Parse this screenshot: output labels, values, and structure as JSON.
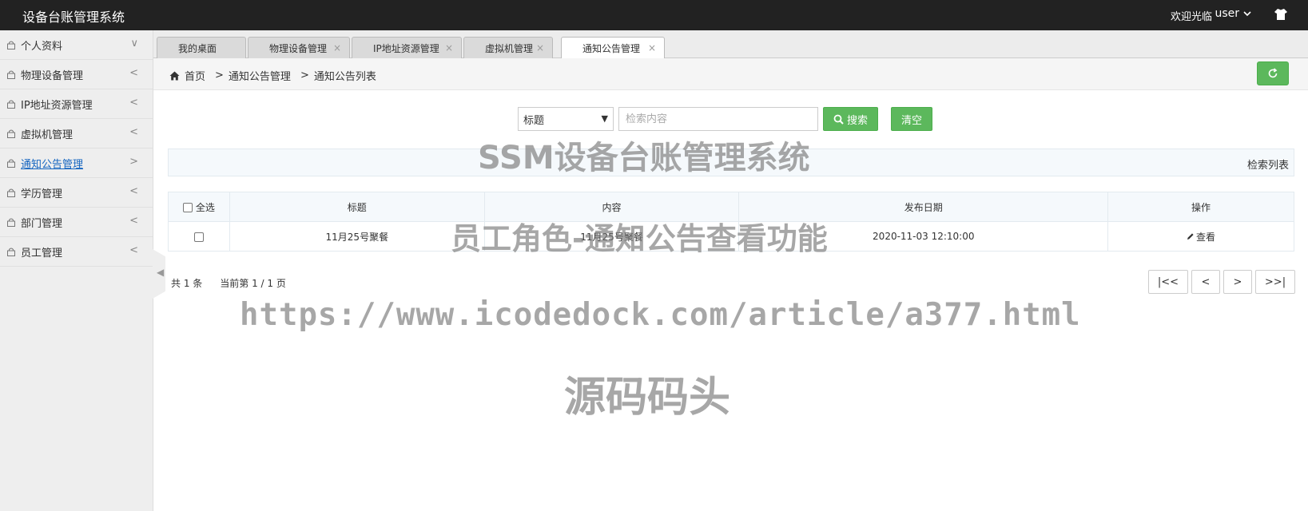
{
  "topbar": {
    "title": "设备台账管理系统",
    "welcome": "欢迎光临",
    "user": "user"
  },
  "sidebar": {
    "items": [
      {
        "label": "个人资料",
        "arrow": "∨"
      },
      {
        "label": "物理设备管理",
        "arrow": "<"
      },
      {
        "label": "IP地址资源管理",
        "arrow": "<"
      },
      {
        "label": "虚拟机管理",
        "arrow": "<"
      },
      {
        "label": "通知公告管理",
        "arrow": ">"
      },
      {
        "label": "学历管理",
        "arrow": "<"
      },
      {
        "label": "部门管理",
        "arrow": "<"
      },
      {
        "label": "员工管理",
        "arrow": "<"
      }
    ]
  },
  "tabs": [
    {
      "label": "我的桌面"
    },
    {
      "label": "物理设备管理"
    },
    {
      "label": "IP地址资源管理"
    },
    {
      "label": "虚拟机管理"
    },
    {
      "label": "通知公告管理"
    }
  ],
  "breadcrumb": {
    "home": "首页",
    "sep": ">",
    "level1": "通知公告管理",
    "level2": "通知公告列表"
  },
  "search": {
    "field": "标题",
    "placeholder": "检索内容",
    "search_label": "搜索",
    "clear_label": "清空"
  },
  "section": {
    "title": "检索列表"
  },
  "table": {
    "select_all": "全选",
    "headers": [
      "标题",
      "内容",
      "发布日期",
      "操作"
    ],
    "rows": [
      {
        "title": "11月25号聚餐",
        "content": "11月25号聚餐",
        "date": "2020-11-03 12:10:00",
        "action": "查看"
      }
    ]
  },
  "pager": {
    "total": "共 1 条",
    "current": "当前第 1 / 1 页",
    "first": "|<<",
    "prev": "<",
    "next": ">",
    "last": ">>|"
  },
  "watermarks": {
    "line1": "SSM设备台账管理系统",
    "line2": "员工角色-通知公告查看功能",
    "line3": "https://www.icodedock.com/article/a377.html",
    "line4": "源码码头"
  }
}
